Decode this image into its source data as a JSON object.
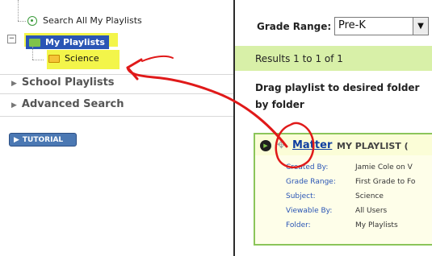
{
  "sidebar": {
    "search_all": "Search All My Playlists",
    "my_playlists": "My Playlists",
    "science": "Science",
    "school_playlists": "School Playlists",
    "advanced_search": "Advanced Search",
    "tutorial": "TUTORIAL"
  },
  "main": {
    "grade_label": "Grade Range:",
    "grade_value": "Pre-K",
    "results": "Results 1 to 1 of 1",
    "drag_hint": "Drag playlist to desired folder by folder",
    "card": {
      "title": "Matter",
      "tag": "MY PLAYLIST (",
      "meta": [
        {
          "k": "Created By:",
          "v": "Jamie Cole on V"
        },
        {
          "k": "Grade Range:",
          "v": "First Grade to Fo"
        },
        {
          "k": "Subject:",
          "v": "Science"
        },
        {
          "k": "Viewable By:",
          "v": "All Users"
        },
        {
          "k": "Folder:",
          "v": "My Playlists"
        }
      ]
    }
  },
  "colors": {
    "highlight": "#f3f54a",
    "annotation_red": "#e01919",
    "selected_blue": "#2a55b5",
    "results_green": "#d8f0a8",
    "card_border": "#8bc55a"
  }
}
